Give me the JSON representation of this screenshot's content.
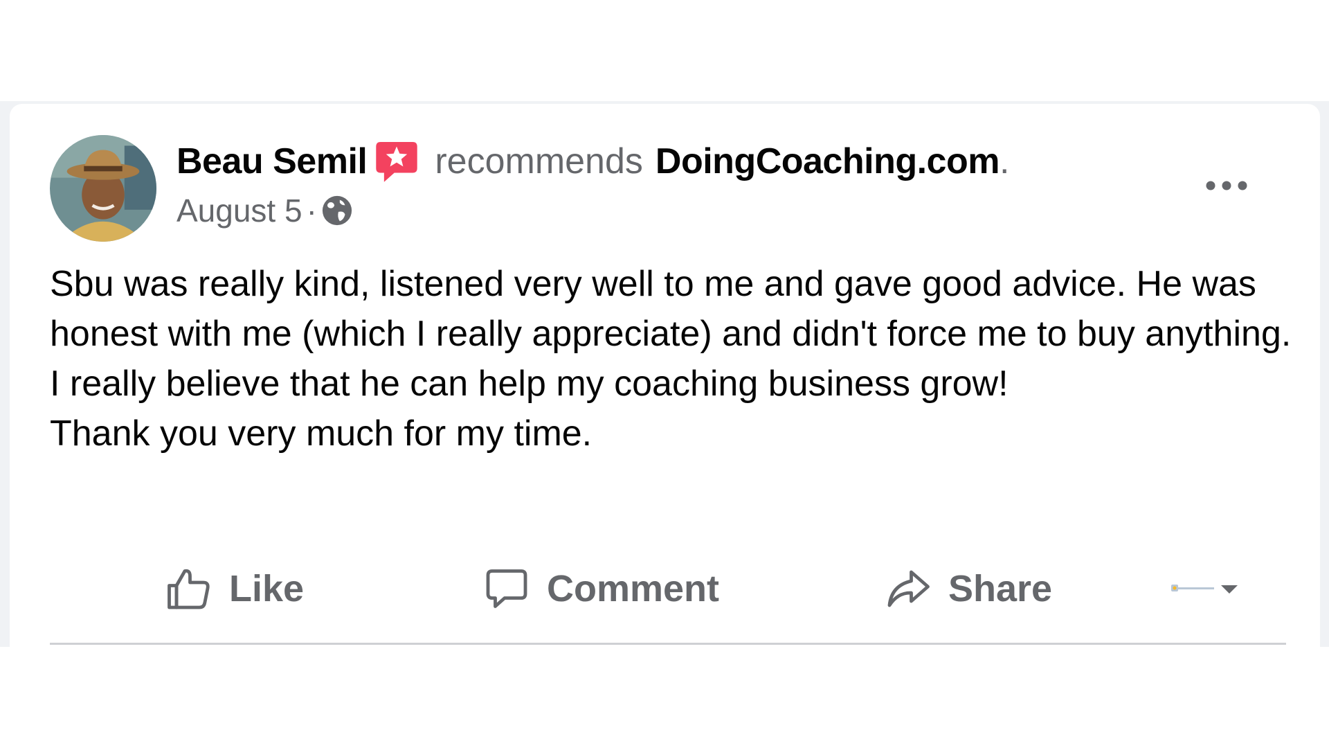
{
  "post": {
    "author": "Beau Semil",
    "recommends_text": "recommends",
    "page_name": "DoingCoaching.com",
    "page_name_suffix": ".",
    "date": "August 5",
    "meta_separator": "·",
    "audience_icon": "globe-icon",
    "body": [
      "Sbu was really kind, listened very well to me and gave good advice. He was honest with me (which I really appreciate) and didn't force me to buy anything.",
      "I really believe that he can help my coaching business grow!",
      "Thank you very much for my time."
    ]
  },
  "actions": {
    "like_label": "Like",
    "comment_label": "Comment",
    "share_label": "Share"
  },
  "icons": {
    "recommend_badge": "recommend-star-icon",
    "more": "more-options-icon",
    "like": "thumbs-up-icon",
    "comment": "comment-bubble-icon",
    "share": "share-arrow-icon",
    "reaction_picker": "chevron-down-icon"
  },
  "colors": {
    "text_primary": "#050505",
    "text_secondary": "#65676b",
    "recommend_badge": "#f3425f",
    "divider": "#ced0d4",
    "backdrop": "#f0f2f5"
  }
}
